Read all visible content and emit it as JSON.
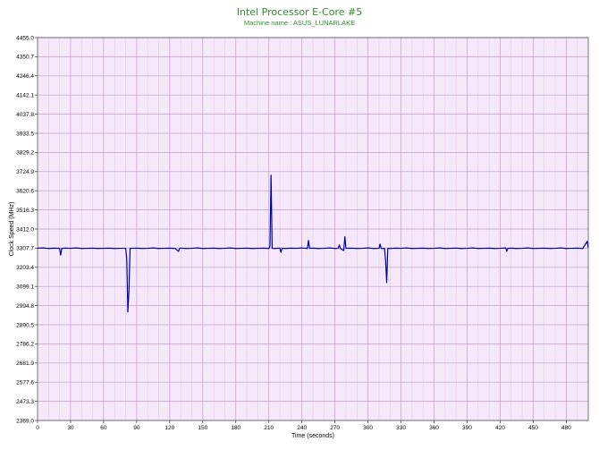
{
  "chart_data": {
    "type": "line",
    "title": "Intel Processor E-Core #5",
    "subtitle": "Machine name : ASUS_LUNARLAKE",
    "xlabel": "Time (seconds)",
    "ylabel": "Clock Speed (MHz)",
    "xlim": [
      0,
      500
    ],
    "ylim": [
      2369.0,
      4455.0
    ],
    "x_ticks": [
      "0",
      "30",
      "60",
      "90",
      "120",
      "150",
      "180",
      "210",
      "240",
      "270",
      "300",
      "330",
      "360",
      "390",
      "420",
      "450",
      "480"
    ],
    "y_ticks": [
      "4455.0",
      "4350.7",
      "4246.4",
      "4142.1",
      "4037.8",
      "3933.5",
      "3829.2",
      "3724.9",
      "3620.6",
      "3516.3",
      "3412.0",
      "3307.7",
      "3203.4",
      "3099.1",
      "2994.8",
      "2890.5",
      "2786.2",
      "2681.9",
      "2577.6",
      "2473.3",
      "2369.0"
    ],
    "grid": true,
    "colors": {
      "plot_bg": "#f6e8fb",
      "grid": "#c39ad0",
      "line": "#0000a8",
      "title": "#2e8b2e"
    },
    "series": [
      {
        "x": [
          0,
          5,
          10,
          15,
          20,
          21,
          22,
          25,
          30,
          35,
          40,
          45,
          50,
          55,
          60,
          65,
          70,
          75,
          80,
          81,
          82,
          83,
          84,
          85,
          90,
          95,
          100,
          105,
          110,
          115,
          120,
          125,
          128,
          129,
          130,
          135,
          140,
          145,
          150,
          155,
          160,
          165,
          170,
          175,
          180,
          185,
          190,
          195,
          200,
          205,
          210,
          211,
          212,
          213,
          215,
          220,
          221,
          222,
          225,
          230,
          235,
          240,
          245,
          246,
          247,
          250,
          255,
          260,
          265,
          270,
          273,
          274,
          275,
          278,
          279,
          280,
          285,
          290,
          295,
          300,
          305,
          310,
          311,
          312,
          315,
          316,
          317,
          318,
          320,
          325,
          330,
          335,
          340,
          345,
          350,
          355,
          360,
          365,
          370,
          375,
          380,
          385,
          390,
          395,
          400,
          405,
          410,
          415,
          420,
          425,
          426,
          427,
          430,
          435,
          440,
          445,
          450,
          455,
          460,
          465,
          470,
          475,
          480,
          485,
          490,
          495,
          499,
          500
        ],
        "y": [
          3307.7,
          3309,
          3306,
          3308,
          3307,
          3270,
          3306,
          3308,
          3307,
          3309,
          3306,
          3307,
          3308,
          3306,
          3307,
          3308,
          3306,
          3307,
          3307,
          3250,
          2960,
          3080,
          3306,
          3307,
          3308,
          3306,
          3307,
          3309,
          3306,
          3307,
          3308,
          3306,
          3290,
          3307,
          3308,
          3306,
          3307,
          3309,
          3306,
          3307,
          3308,
          3306,
          3307,
          3309,
          3306,
          3307,
          3308,
          3306,
          3307,
          3308,
          3306,
          3320,
          3705,
          3307,
          3306,
          3308,
          3285,
          3307,
          3306,
          3308,
          3307,
          3309,
          3306,
          3350,
          3307,
          3308,
          3306,
          3307,
          3309,
          3306,
          3307,
          3325,
          3306,
          3295,
          3370,
          3307,
          3308,
          3306,
          3307,
          3309,
          3306,
          3307,
          3330,
          3306,
          3307,
          3240,
          3120,
          3307,
          3306,
          3308,
          3307,
          3309,
          3306,
          3307,
          3308,
          3306,
          3307,
          3309,
          3306,
          3307,
          3308,
          3306,
          3307,
          3309,
          3306,
          3307,
          3308,
          3306,
          3307,
          3309,
          3290,
          3307,
          3308,
          3306,
          3307,
          3309,
          3306,
          3307,
          3308,
          3306,
          3307,
          3309,
          3306,
          3307,
          3308,
          3306,
          3345,
          3310
        ]
      }
    ]
  }
}
